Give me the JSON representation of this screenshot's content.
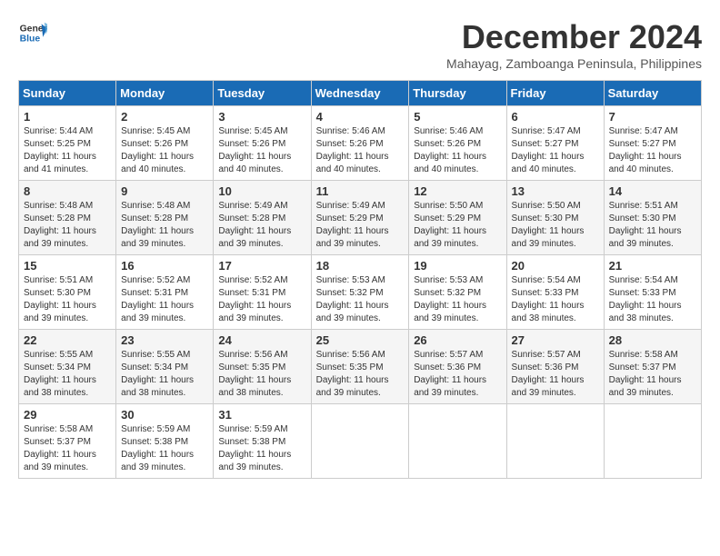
{
  "header": {
    "logo_line1": "General",
    "logo_line2": "Blue",
    "month_title": "December 2024",
    "location": "Mahayag, Zamboanga Peninsula, Philippines"
  },
  "weekdays": [
    "Sunday",
    "Monday",
    "Tuesday",
    "Wednesday",
    "Thursday",
    "Friday",
    "Saturday"
  ],
  "weeks": [
    [
      {
        "day": "1",
        "sunrise": "5:44 AM",
        "sunset": "5:25 PM",
        "daylight": "11 hours and 41 minutes."
      },
      {
        "day": "2",
        "sunrise": "5:45 AM",
        "sunset": "5:26 PM",
        "daylight": "11 hours and 40 minutes."
      },
      {
        "day": "3",
        "sunrise": "5:45 AM",
        "sunset": "5:26 PM",
        "daylight": "11 hours and 40 minutes."
      },
      {
        "day": "4",
        "sunrise": "5:46 AM",
        "sunset": "5:26 PM",
        "daylight": "11 hours and 40 minutes."
      },
      {
        "day": "5",
        "sunrise": "5:46 AM",
        "sunset": "5:26 PM",
        "daylight": "11 hours and 40 minutes."
      },
      {
        "day": "6",
        "sunrise": "5:47 AM",
        "sunset": "5:27 PM",
        "daylight": "11 hours and 40 minutes."
      },
      {
        "day": "7",
        "sunrise": "5:47 AM",
        "sunset": "5:27 PM",
        "daylight": "11 hours and 40 minutes."
      }
    ],
    [
      {
        "day": "8",
        "sunrise": "5:48 AM",
        "sunset": "5:28 PM",
        "daylight": "11 hours and 39 minutes."
      },
      {
        "day": "9",
        "sunrise": "5:48 AM",
        "sunset": "5:28 PM",
        "daylight": "11 hours and 39 minutes."
      },
      {
        "day": "10",
        "sunrise": "5:49 AM",
        "sunset": "5:28 PM",
        "daylight": "11 hours and 39 minutes."
      },
      {
        "day": "11",
        "sunrise": "5:49 AM",
        "sunset": "5:29 PM",
        "daylight": "11 hours and 39 minutes."
      },
      {
        "day": "12",
        "sunrise": "5:50 AM",
        "sunset": "5:29 PM",
        "daylight": "11 hours and 39 minutes."
      },
      {
        "day": "13",
        "sunrise": "5:50 AM",
        "sunset": "5:30 PM",
        "daylight": "11 hours and 39 minutes."
      },
      {
        "day": "14",
        "sunrise": "5:51 AM",
        "sunset": "5:30 PM",
        "daylight": "11 hours and 39 minutes."
      }
    ],
    [
      {
        "day": "15",
        "sunrise": "5:51 AM",
        "sunset": "5:30 PM",
        "daylight": "11 hours and 39 minutes."
      },
      {
        "day": "16",
        "sunrise": "5:52 AM",
        "sunset": "5:31 PM",
        "daylight": "11 hours and 39 minutes."
      },
      {
        "day": "17",
        "sunrise": "5:52 AM",
        "sunset": "5:31 PM",
        "daylight": "11 hours and 39 minutes."
      },
      {
        "day": "18",
        "sunrise": "5:53 AM",
        "sunset": "5:32 PM",
        "daylight": "11 hours and 39 minutes."
      },
      {
        "day": "19",
        "sunrise": "5:53 AM",
        "sunset": "5:32 PM",
        "daylight": "11 hours and 39 minutes."
      },
      {
        "day": "20",
        "sunrise": "5:54 AM",
        "sunset": "5:33 PM",
        "daylight": "11 hours and 38 minutes."
      },
      {
        "day": "21",
        "sunrise": "5:54 AM",
        "sunset": "5:33 PM",
        "daylight": "11 hours and 38 minutes."
      }
    ],
    [
      {
        "day": "22",
        "sunrise": "5:55 AM",
        "sunset": "5:34 PM",
        "daylight": "11 hours and 38 minutes."
      },
      {
        "day": "23",
        "sunrise": "5:55 AM",
        "sunset": "5:34 PM",
        "daylight": "11 hours and 38 minutes."
      },
      {
        "day": "24",
        "sunrise": "5:56 AM",
        "sunset": "5:35 PM",
        "daylight": "11 hours and 38 minutes."
      },
      {
        "day": "25",
        "sunrise": "5:56 AM",
        "sunset": "5:35 PM",
        "daylight": "11 hours and 39 minutes."
      },
      {
        "day": "26",
        "sunrise": "5:57 AM",
        "sunset": "5:36 PM",
        "daylight": "11 hours and 39 minutes."
      },
      {
        "day": "27",
        "sunrise": "5:57 AM",
        "sunset": "5:36 PM",
        "daylight": "11 hours and 39 minutes."
      },
      {
        "day": "28",
        "sunrise": "5:58 AM",
        "sunset": "5:37 PM",
        "daylight": "11 hours and 39 minutes."
      }
    ],
    [
      {
        "day": "29",
        "sunrise": "5:58 AM",
        "sunset": "5:37 PM",
        "daylight": "11 hours and 39 minutes."
      },
      {
        "day": "30",
        "sunrise": "5:59 AM",
        "sunset": "5:38 PM",
        "daylight": "11 hours and 39 minutes."
      },
      {
        "day": "31",
        "sunrise": "5:59 AM",
        "sunset": "5:38 PM",
        "daylight": "11 hours and 39 minutes."
      },
      null,
      null,
      null,
      null
    ]
  ]
}
